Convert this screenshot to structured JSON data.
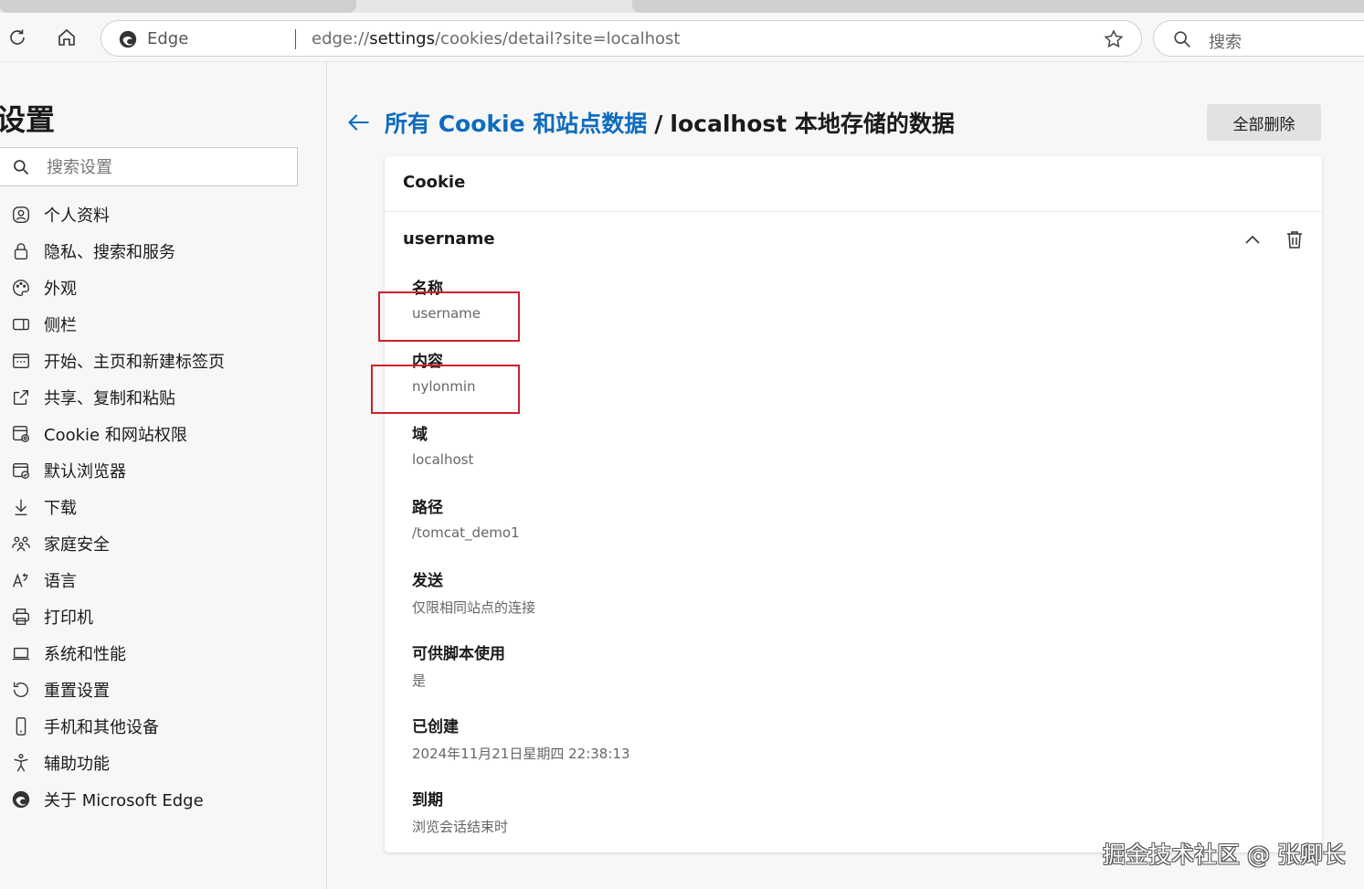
{
  "toolbar": {
    "edge_label": "Edge",
    "url_prefix": "edge://",
    "url_strong": "settings",
    "url_rest": "/cookies/detail?site=localhost",
    "search_placeholder": "搜索"
  },
  "sidebar": {
    "title": "设置",
    "search_placeholder": "搜索设置",
    "items": [
      {
        "label": "个人资料",
        "icon": "profile-icon"
      },
      {
        "label": "隐私、搜索和服务",
        "icon": "lock-icon"
      },
      {
        "label": "外观",
        "icon": "palette-icon"
      },
      {
        "label": "侧栏",
        "icon": "sidebar-icon"
      },
      {
        "label": "开始、主页和新建标签页",
        "icon": "newtab-icon"
      },
      {
        "label": "共享、复制和粘贴",
        "icon": "share-icon"
      },
      {
        "label": "Cookie 和网站权限",
        "icon": "site-permissions-icon"
      },
      {
        "label": "默认浏览器",
        "icon": "browser-icon"
      },
      {
        "label": "下载",
        "icon": "download-icon"
      },
      {
        "label": "家庭安全",
        "icon": "family-icon"
      },
      {
        "label": "语言",
        "icon": "language-icon"
      },
      {
        "label": "打印机",
        "icon": "printer-icon"
      },
      {
        "label": "系统和性能",
        "icon": "laptop-icon"
      },
      {
        "label": "重置设置",
        "icon": "reset-icon"
      },
      {
        "label": "手机和其他设备",
        "icon": "phone-icon"
      },
      {
        "label": "辅助功能",
        "icon": "accessibility-icon"
      },
      {
        "label": "关于 Microsoft Edge",
        "icon": "edge-logo-icon"
      }
    ]
  },
  "main": {
    "breadcrumb_link": "所有 Cookie 和站点数据",
    "breadcrumb_sep": "/",
    "breadcrumb_current": "localhost 本地存储的数据",
    "delete_all_label": "全部删除",
    "card_title": "Cookie",
    "cookie_name": "username",
    "fields": [
      {
        "key": "名称",
        "value": "username"
      },
      {
        "key": "内容",
        "value": "nylonmin"
      },
      {
        "key": "域",
        "value": "localhost"
      },
      {
        "key": "路径",
        "value": "/tomcat_demo1"
      },
      {
        "key": "发送",
        "value": "仅限相同站点的连接"
      },
      {
        "key": "可供脚本使用",
        "value": "是"
      },
      {
        "key": "已创建",
        "value": "2024年11月21日星期四 22:38:13"
      },
      {
        "key": "到期",
        "value": "浏览会话结束时"
      }
    ]
  },
  "watermark": "掘金技术社区 @ 张卿长",
  "colors": {
    "accent": "#0f6cbd",
    "highlight": "#d0202a"
  }
}
